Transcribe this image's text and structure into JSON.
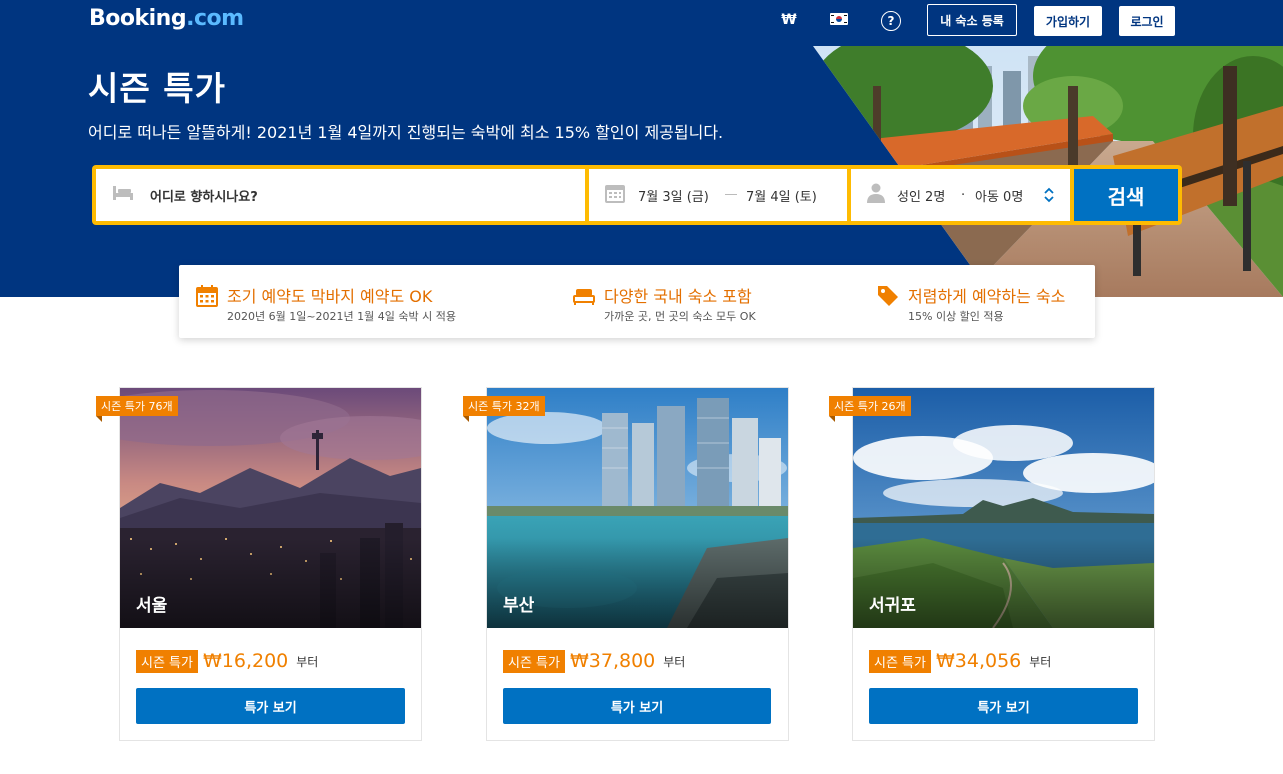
{
  "header": {
    "logo_main": "Booking",
    "logo_suffix": ".com",
    "currency": "₩",
    "help_icon": "?",
    "register_label": "내 숙소 등록",
    "signup_label": "가입하기",
    "login_label": "로그인"
  },
  "hero": {
    "title": "시즌 특가",
    "subtitle": "어디로 떠나든 알뜰하게! 2021년 1월 4일까지 진행되는 숙박에 최소 15% 할인이 제공됩니다."
  },
  "search": {
    "destination_placeholder": "어디로 향하시나요?",
    "checkin": "7월 3일 (금)",
    "checkout": "7월 4일 (토)",
    "adults": "성인 2명",
    "separator": "·",
    "children": "아동 0명",
    "button": "검색"
  },
  "features": [
    {
      "icon": "calendar-icon",
      "title": "조기 예약도 막바지 예약도 OK",
      "sub": "2020년 6월 1일~2021년 1월 4일 숙박 시 적용"
    },
    {
      "icon": "bed-icon",
      "title": "다양한 국내 숙소 포함",
      "sub": "가까운 곳, 먼 곳의 숙소 모두 OK"
    },
    {
      "icon": "price-tag-icon",
      "title": "저렴하게 예약하는 숙소",
      "sub": "15% 이상 할인 적용"
    }
  ],
  "cards": [
    {
      "ribbon": "시즌 특가 76개",
      "city": "서울",
      "tag": "시즌 특가",
      "price": "₩16,200",
      "from": "부터",
      "button": "특가 보기"
    },
    {
      "ribbon": "시즌 특가 32개",
      "city": "부산",
      "tag": "시즌 특가",
      "price": "₩37,800",
      "from": "부터",
      "button": "특가 보기"
    },
    {
      "ribbon": "시즌 특가 26개",
      "city": "서귀포",
      "tag": "시즌 특가",
      "price": "₩34,056",
      "from": "부터",
      "button": "특가 보기"
    }
  ],
  "colors": {
    "brand_blue": "#003580",
    "action_blue": "#0071c2",
    "search_yellow": "#febb02",
    "deal_orange": "#f08000"
  }
}
